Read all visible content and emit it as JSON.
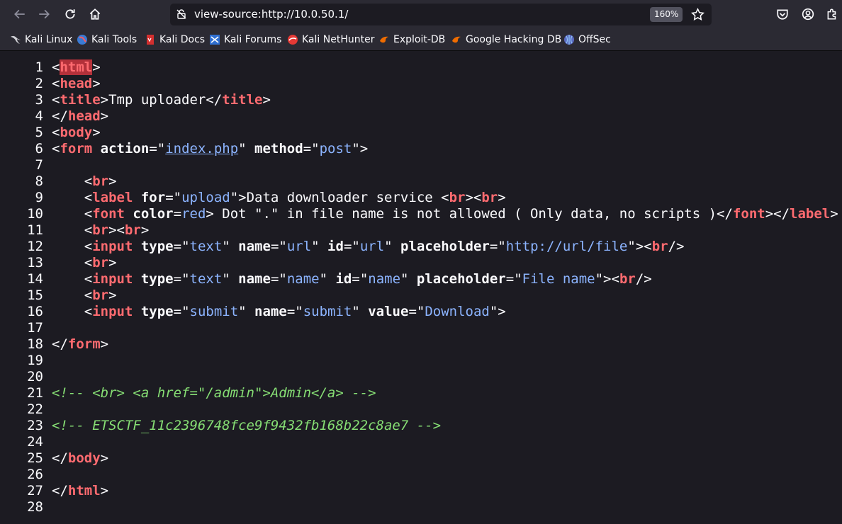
{
  "browser": {
    "url": "view-source:http://10.0.50.1/",
    "zoom": "160%"
  },
  "bookmarks": [
    {
      "label": "Kali Linux",
      "icon": "kali-dragon-icon"
    },
    {
      "label": "Kali Tools",
      "icon": "kali-tools-icon"
    },
    {
      "label": "Kali Docs",
      "icon": "kali-docs-icon"
    },
    {
      "label": "Kali Forums",
      "icon": "kali-forums-icon"
    },
    {
      "label": "Kali NetHunter",
      "icon": "kali-nethunter-icon"
    },
    {
      "label": "Exploit-DB",
      "icon": "exploit-db-icon"
    },
    {
      "label": "Google Hacking DB",
      "icon": "ghdb-icon"
    },
    {
      "label": "OffSec",
      "icon": "offsec-icon"
    }
  ],
  "source_lines": [
    {
      "n": "1",
      "parts": [
        [
          "p",
          "<"
        ],
        [
          "hltag",
          "html"
        ],
        [
          "p",
          ">"
        ]
      ]
    },
    {
      "n": "2",
      "parts": [
        [
          "p",
          "<"
        ],
        [
          "tag",
          "head"
        ],
        [
          "p",
          ">"
        ]
      ]
    },
    {
      "n": "3",
      "parts": [
        [
          "p",
          "<"
        ],
        [
          "tag",
          "title"
        ],
        [
          "p",
          ">Tmp uploader</"
        ],
        [
          "tag",
          "title"
        ],
        [
          "p",
          ">"
        ]
      ]
    },
    {
      "n": "4",
      "parts": [
        [
          "p",
          "</"
        ],
        [
          "tag",
          "head"
        ],
        [
          "p",
          ">"
        ]
      ]
    },
    {
      "n": "5",
      "parts": [
        [
          "p",
          "<"
        ],
        [
          "tag",
          "body"
        ],
        [
          "p",
          ">"
        ]
      ]
    },
    {
      "n": "6",
      "parts": [
        [
          "p",
          "<"
        ],
        [
          "tag",
          "form"
        ],
        [
          "p",
          " "
        ],
        [
          "attr",
          "action"
        ],
        [
          "p",
          "=\""
        ],
        [
          "link",
          "index.php"
        ],
        [
          "p",
          "\" "
        ],
        [
          "attr",
          "method"
        ],
        [
          "p",
          "=\""
        ],
        [
          "val",
          "post"
        ],
        [
          "p",
          "\">"
        ]
      ]
    },
    {
      "n": "7",
      "parts": []
    },
    {
      "n": "8",
      "parts": [
        [
          "p",
          "    <"
        ],
        [
          "tag",
          "br"
        ],
        [
          "p",
          ">"
        ]
      ]
    },
    {
      "n": "9",
      "parts": [
        [
          "p",
          "    <"
        ],
        [
          "tag",
          "label"
        ],
        [
          "p",
          " "
        ],
        [
          "attr",
          "for"
        ],
        [
          "p",
          "=\""
        ],
        [
          "val",
          "upload"
        ],
        [
          "p",
          "\">Data downloader service <"
        ],
        [
          "tag",
          "br"
        ],
        [
          "p",
          "><"
        ],
        [
          "tag",
          "br"
        ],
        [
          "p",
          ">"
        ]
      ]
    },
    {
      "n": "10",
      "parts": [
        [
          "p",
          "    <"
        ],
        [
          "tag",
          "font"
        ],
        [
          "p",
          " "
        ],
        [
          "attr",
          "color"
        ],
        [
          "p",
          "="
        ],
        [
          "val",
          "red"
        ],
        [
          "p",
          "> Dot \".\" in file name is not allowed ( Only data, no scripts )</"
        ],
        [
          "tag",
          "font"
        ],
        [
          "p",
          "></"
        ],
        [
          "tag",
          "label"
        ],
        [
          "p",
          ">"
        ]
      ]
    },
    {
      "n": "11",
      "parts": [
        [
          "p",
          "    <"
        ],
        [
          "tag",
          "br"
        ],
        [
          "p",
          "><"
        ],
        [
          "tag",
          "br"
        ],
        [
          "p",
          ">"
        ]
      ]
    },
    {
      "n": "12",
      "parts": [
        [
          "p",
          "    <"
        ],
        [
          "tag",
          "input"
        ],
        [
          "p",
          " "
        ],
        [
          "attr",
          "type"
        ],
        [
          "p",
          "=\""
        ],
        [
          "val",
          "text"
        ],
        [
          "p",
          "\" "
        ],
        [
          "attr",
          "name"
        ],
        [
          "p",
          "=\""
        ],
        [
          "val",
          "url"
        ],
        [
          "p",
          "\" "
        ],
        [
          "attr",
          "id"
        ],
        [
          "p",
          "=\""
        ],
        [
          "val",
          "url"
        ],
        [
          "p",
          "\" "
        ],
        [
          "attr",
          "placeholder"
        ],
        [
          "p",
          "=\""
        ],
        [
          "val",
          "http://url/file"
        ],
        [
          "p",
          "\"><"
        ],
        [
          "tag",
          "br"
        ],
        [
          "p",
          "/>"
        ]
      ]
    },
    {
      "n": "13",
      "parts": [
        [
          "p",
          "    <"
        ],
        [
          "tag",
          "br"
        ],
        [
          "p",
          ">"
        ]
      ]
    },
    {
      "n": "14",
      "parts": [
        [
          "p",
          "    <"
        ],
        [
          "tag",
          "input"
        ],
        [
          "p",
          " "
        ],
        [
          "attr",
          "type"
        ],
        [
          "p",
          "=\""
        ],
        [
          "val",
          "text"
        ],
        [
          "p",
          "\" "
        ],
        [
          "attr",
          "name"
        ],
        [
          "p",
          "=\""
        ],
        [
          "val",
          "name"
        ],
        [
          "p",
          "\" "
        ],
        [
          "attr",
          "id"
        ],
        [
          "p",
          "=\""
        ],
        [
          "val",
          "name"
        ],
        [
          "p",
          "\" "
        ],
        [
          "attr",
          "placeholder"
        ],
        [
          "p",
          "=\""
        ],
        [
          "val",
          "File name"
        ],
        [
          "p",
          "\"><"
        ],
        [
          "tag",
          "br"
        ],
        [
          "p",
          "/>"
        ]
      ]
    },
    {
      "n": "15",
      "parts": [
        [
          "p",
          "    <"
        ],
        [
          "tag",
          "br"
        ],
        [
          "p",
          ">"
        ]
      ]
    },
    {
      "n": "16",
      "parts": [
        [
          "p",
          "    <"
        ],
        [
          "tag",
          "input"
        ],
        [
          "p",
          " "
        ],
        [
          "attr",
          "type"
        ],
        [
          "p",
          "=\""
        ],
        [
          "val",
          "submit"
        ],
        [
          "p",
          "\" "
        ],
        [
          "attr",
          "name"
        ],
        [
          "p",
          "=\""
        ],
        [
          "val",
          "submit"
        ],
        [
          "p",
          "\" "
        ],
        [
          "attr",
          "value"
        ],
        [
          "p",
          "=\""
        ],
        [
          "val",
          "Download"
        ],
        [
          "p",
          "\">"
        ]
      ]
    },
    {
      "n": "17",
      "parts": []
    },
    {
      "n": "18",
      "parts": [
        [
          "p",
          "</"
        ],
        [
          "tag",
          "form"
        ],
        [
          "p",
          ">"
        ]
      ]
    },
    {
      "n": "19",
      "parts": []
    },
    {
      "n": "20",
      "parts": []
    },
    {
      "n": "21",
      "parts": [
        [
          "cmt",
          "<!-- <br> <a href=\"/admin\">Admin</a> -->"
        ]
      ]
    },
    {
      "n": "22",
      "parts": []
    },
    {
      "n": "23",
      "parts": [
        [
          "cmt",
          "<!-- ETSCTF_11c2396748fce9f9432fb168b22c8ae7 -->"
        ]
      ]
    },
    {
      "n": "24",
      "parts": []
    },
    {
      "n": "25",
      "parts": [
        [
          "p",
          "</"
        ],
        [
          "tag",
          "body"
        ],
        [
          "p",
          ">"
        ]
      ]
    },
    {
      "n": "26",
      "parts": []
    },
    {
      "n": "27",
      "parts": [
        [
          "p",
          "</"
        ],
        [
          "tag",
          "html"
        ],
        [
          "p",
          ">"
        ]
      ]
    },
    {
      "n": "28",
      "parts": []
    }
  ]
}
